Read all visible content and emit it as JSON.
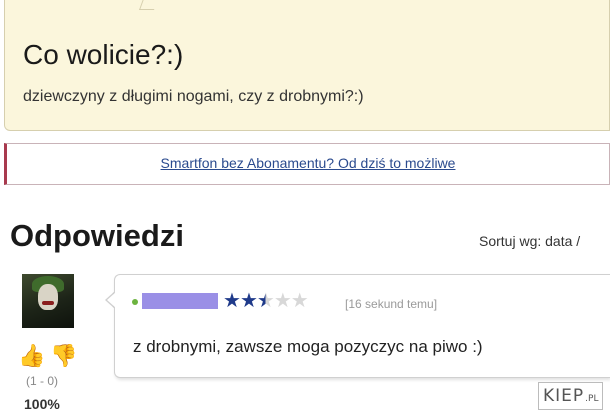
{
  "question": {
    "title": "Co wolicie?:)",
    "body": "dziewczyny z długimi nogami, czy z drobnymi?:)"
  },
  "ad": {
    "link_text": "Smartfon bez Abonamentu? Od dziś to możliwe"
  },
  "answers_section": {
    "title": "Odpowiedzi",
    "sort_label": "Sortuj wg: data /"
  },
  "answer": {
    "rating": {
      "value": 2.5,
      "max": 5
    },
    "timestamp": "[16 sekund temu]",
    "text": "z drobnymi, zawsze moga pozyczyc na piwo :)",
    "votes": {
      "counts": "(1 - 0)",
      "percent": "100%"
    },
    "icons": {
      "upvote": "thumbs-up-icon",
      "downvote": "thumbs-down-icon"
    }
  },
  "watermark": {
    "main": "KIEP",
    "sub": ".PL"
  },
  "colors": {
    "question_bg": "#fbf6dc",
    "ad_border_accent": "#a83a4e",
    "link": "#2a4a8e",
    "star_active": "#1f3a8a",
    "username_highlight": "#9a8fe6",
    "online": "#6cb33f"
  }
}
